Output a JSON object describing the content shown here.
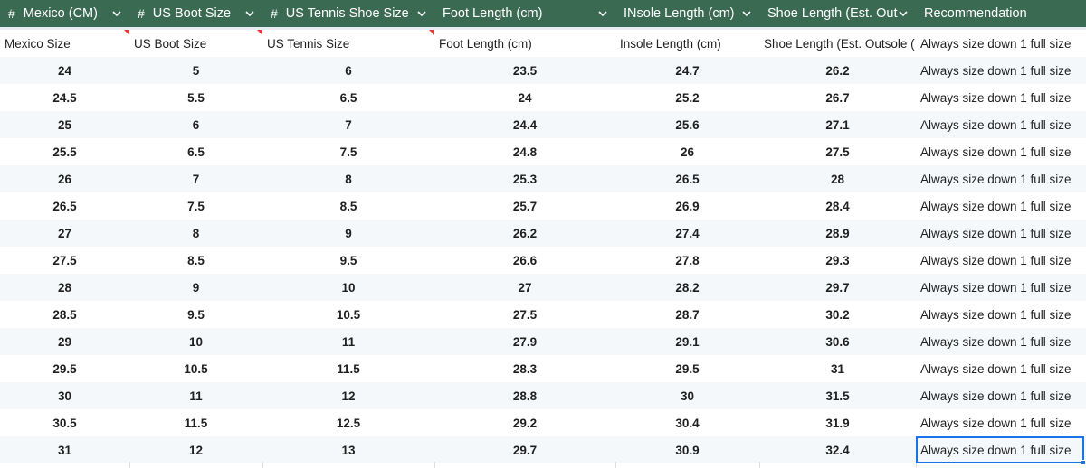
{
  "headers": [
    {
      "label": "Mexico (CM)",
      "typed": true
    },
    {
      "label": "US Boot Size",
      "typed": true
    },
    {
      "label": "US Tennis Shoe Size",
      "typed": true
    },
    {
      "label": "Foot Length (cm)",
      "typed": false
    },
    {
      "label": "INsole Length (cm)",
      "typed": false
    },
    {
      "label": "Shoe Length (Est. Outs",
      "typed": false
    },
    {
      "label": "Recommendation",
      "typed": false
    }
  ],
  "subheaders": [
    "Mexico Size",
    "US Boot Size",
    "US Tennis Size",
    "Foot Length (cm)",
    "Insole Length (cm)",
    "Shoe Length (Est. Outsole (",
    "Always size down 1 full size"
  ],
  "rows": [
    [
      "24",
      "5",
      "6",
      "23.5",
      "24.7",
      "26.2",
      "Always size down 1 full size"
    ],
    [
      "24.5",
      "5.5",
      "6.5",
      "24",
      "25.2",
      "26.7",
      "Always size down 1 full size"
    ],
    [
      "25",
      "6",
      "7",
      "24.4",
      "25.6",
      "27.1",
      "Always size down 1 full size"
    ],
    [
      "25.5",
      "6.5",
      "7.5",
      "24.8",
      "26",
      "27.5",
      "Always size down 1 full size"
    ],
    [
      "26",
      "7",
      "8",
      "25.3",
      "26.5",
      "28",
      "Always size down 1 full size"
    ],
    [
      "26.5",
      "7.5",
      "8.5",
      "25.7",
      "26.9",
      "28.4",
      "Always size down 1 full size"
    ],
    [
      "27",
      "8",
      "9",
      "26.2",
      "27.4",
      "28.9",
      "Always size down 1 full size"
    ],
    [
      "27.5",
      "8.5",
      "9.5",
      "26.6",
      "27.8",
      "29.3",
      "Always size down 1 full size"
    ],
    [
      "28",
      "9",
      "10",
      "27",
      "28.2",
      "29.7",
      "Always size down 1 full size"
    ],
    [
      "28.5",
      "9.5",
      "10.5",
      "27.5",
      "28.7",
      "30.2",
      "Always size down 1 full size"
    ],
    [
      "29",
      "10",
      "11",
      "27.9",
      "29.1",
      "30.6",
      "Always size down 1 full size"
    ],
    [
      "29.5",
      "10.5",
      "11.5",
      "28.3",
      "29.5",
      "31",
      "Always size down 1 full size"
    ],
    [
      "30",
      "11",
      "12",
      "28.8",
      "30",
      "31.5",
      "Always size down 1 full size"
    ],
    [
      "30.5",
      "11.5",
      "12.5",
      "29.2",
      "30.4",
      "31.9",
      "Always size down 1 full size"
    ],
    [
      "31",
      "12",
      "13",
      "29.7",
      "30.9",
      "32.4",
      "Always size down 1 full size"
    ]
  ],
  "icons": {
    "typed_column": "hash-icon",
    "dropdown": "chevron-down-icon",
    "note": "comment-indicator-icon"
  },
  "selected_cell": {
    "row": 15,
    "column": "Recommendation"
  },
  "colors": {
    "header_bg": "#3a6b52",
    "header_text": "#ffffff",
    "row_alt": "#f5f8fa",
    "selection": "#1a73e8",
    "note_marker": "#e53935"
  }
}
